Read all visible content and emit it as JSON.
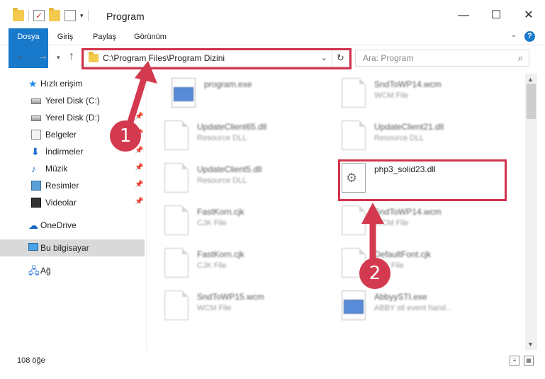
{
  "window": {
    "title": "Program",
    "minimize": "—",
    "maximize": "☐",
    "close": "✕"
  },
  "ribbon": {
    "tabs": [
      "Dosya",
      "Giriş",
      "Paylaş",
      "Görünüm"
    ],
    "expand": "⌄",
    "help": "?"
  },
  "nav": {
    "back": "←",
    "forward": "→",
    "recent": "▾",
    "up": "↑",
    "address": "C:\\Program Files\\Program Dizini",
    "address_drop": "⌄",
    "refresh": "↻",
    "search_placeholder": "Ara: Program",
    "search_icon": "⌕"
  },
  "sidebar": {
    "items": [
      {
        "label": "Hızlı erişim",
        "icon": "star-icon"
      },
      {
        "label": "Yerel Disk (C:)",
        "icon": "disk-icon"
      },
      {
        "label": "Yerel Disk (D:)",
        "icon": "disk-icon",
        "pinned": true
      },
      {
        "label": "Belgeler",
        "icon": "documents-icon",
        "pinned": true
      },
      {
        "label": "İndirmeler",
        "icon": "download-icon",
        "pinned": true
      },
      {
        "label": "Müzik",
        "icon": "music-icon",
        "pinned": true
      },
      {
        "label": "Resimler",
        "icon": "pictures-icon",
        "pinned": true
      },
      {
        "label": "Videolar",
        "icon": "videos-icon",
        "pinned": true
      },
      {
        "label": "OneDrive",
        "icon": "cloud-icon"
      },
      {
        "label": "Bu bilgisayar",
        "icon": "pc-icon"
      },
      {
        "label": "Ağ",
        "icon": "network-icon"
      }
    ],
    "pin_glyph": "📌"
  },
  "files": [
    {
      "name": "program.exe",
      "type": "",
      "icon": "exe"
    },
    {
      "name": "SndToWP14.wcm",
      "type": "WCM File",
      "icon": "page"
    },
    {
      "name": "UpdateClient65.dll",
      "type": "Resource DLL",
      "icon": "page"
    },
    {
      "name": "UpdateClient21.dll",
      "type": "Resource DLL",
      "icon": "page"
    },
    {
      "name": "UpdateClient5.dll",
      "type": "Resource DLL",
      "icon": "page"
    },
    {
      "name": "php3_solid23.dll",
      "type": "",
      "icon": "gear"
    },
    {
      "name": "FastKorn.cjk",
      "type": "CJK File",
      "icon": "page"
    },
    {
      "name": "SndToWP14.wcm",
      "type": "WCM File",
      "icon": "page"
    },
    {
      "name": "FastKorn.cjk",
      "type": "CJK File",
      "icon": "page"
    },
    {
      "name": "DefaultFont.cjk",
      "type": "CJK File",
      "icon": "page"
    },
    {
      "name": "SndToWP15.wcm",
      "type": "WCM File",
      "icon": "page"
    },
    {
      "name": "AbbyySTI.exe",
      "type": "ABBY sti event hand...",
      "icon": "exe"
    }
  ],
  "gear_glyph": "⚙",
  "status": {
    "count": "108 öğe",
    "details_view": "≡",
    "icons_view": "▦"
  },
  "annotations": {
    "badge1": "1",
    "badge2": "2",
    "color": "#d0314b"
  }
}
